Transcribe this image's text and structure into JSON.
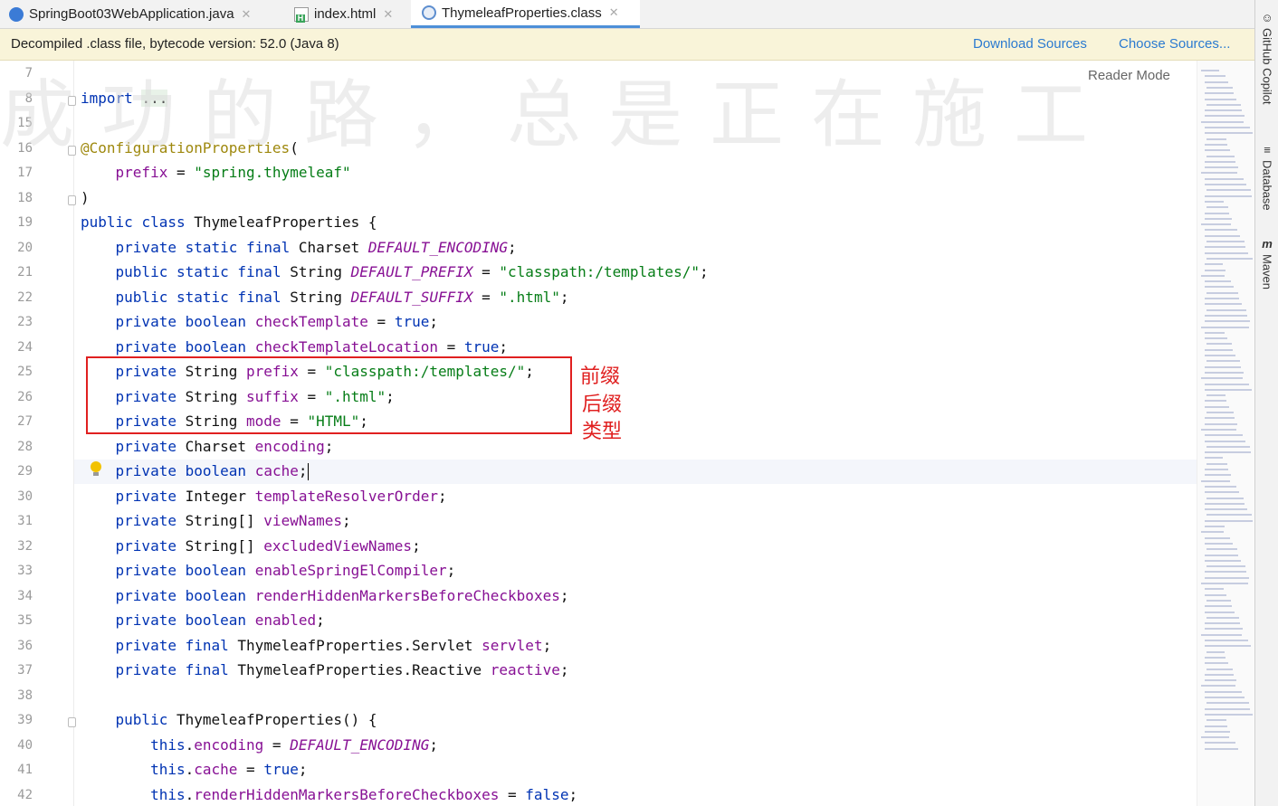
{
  "tabs": [
    {
      "label": "SpringBoot03WebApplication.java",
      "icon": "java-class-icon",
      "active": false
    },
    {
      "label": "index.html",
      "icon": "html-file-icon",
      "active": false
    },
    {
      "label": "ThymeleafProperties.class",
      "icon": "class-file-icon",
      "active": true
    }
  ],
  "notice": {
    "message": "Decompiled .class file, bytecode version: 52.0 (Java 8)",
    "download_sources": "Download Sources",
    "choose_sources": "Choose Sources..."
  },
  "right_tools": [
    {
      "label": "GitHub Copilot",
      "icon": "copilot-icon"
    },
    {
      "label": "Database",
      "icon": "database-icon"
    },
    {
      "label": "Maven",
      "icon": "maven-icon"
    }
  ],
  "editor": {
    "reader_mode": "Reader Mode",
    "watermark": "成功的路，总是正在施工",
    "line_numbers": [
      "7",
      "8",
      "15",
      "16",
      "17",
      "18",
      "19",
      "20",
      "21",
      "22",
      "23",
      "24",
      "25",
      "26",
      "27",
      "28",
      "29",
      "30",
      "31",
      "32",
      "33",
      "34",
      "35",
      "36",
      "37",
      "38",
      "39",
      "40",
      "41",
      "42"
    ],
    "code": [
      "",
      "import ...",
      "",
      "@ConfigurationProperties(",
      "    prefix = \"spring.thymeleaf\"",
      ")",
      "public class ThymeleafProperties {",
      "    private static final Charset DEFAULT_ENCODING;",
      "    public static final String DEFAULT_PREFIX = \"classpath:/templates/\";",
      "    public static final String DEFAULT_SUFFIX = \".html\";",
      "    private boolean checkTemplate = true;",
      "    private boolean checkTemplateLocation = true;",
      "    private String prefix = \"classpath:/templates/\";",
      "    private String suffix = \".html\";",
      "    private String mode = \"HTML\";",
      "    private Charset encoding;",
      "    private boolean cache;",
      "    private Integer templateResolverOrder;",
      "    private String[] viewNames;",
      "    private String[] excludedViewNames;",
      "    private boolean enableSpringElCompiler;",
      "    private boolean renderHiddenMarkersBeforeCheckboxes;",
      "    private boolean enabled;",
      "    private final ThymeleafProperties.Servlet servlet;",
      "    private final ThymeleafProperties.Reactive reactive;",
      "",
      "    public ThymeleafProperties() {",
      "        this.encoding = DEFAULT_ENCODING;",
      "        this.cache = true;",
      "        this.renderHiddenMarkersBeforeCheckboxes = false;"
    ]
  },
  "annotations": {
    "prefix": "前缀",
    "suffix": "后缀",
    "type": "类型",
    "box_color": "#e02020"
  }
}
